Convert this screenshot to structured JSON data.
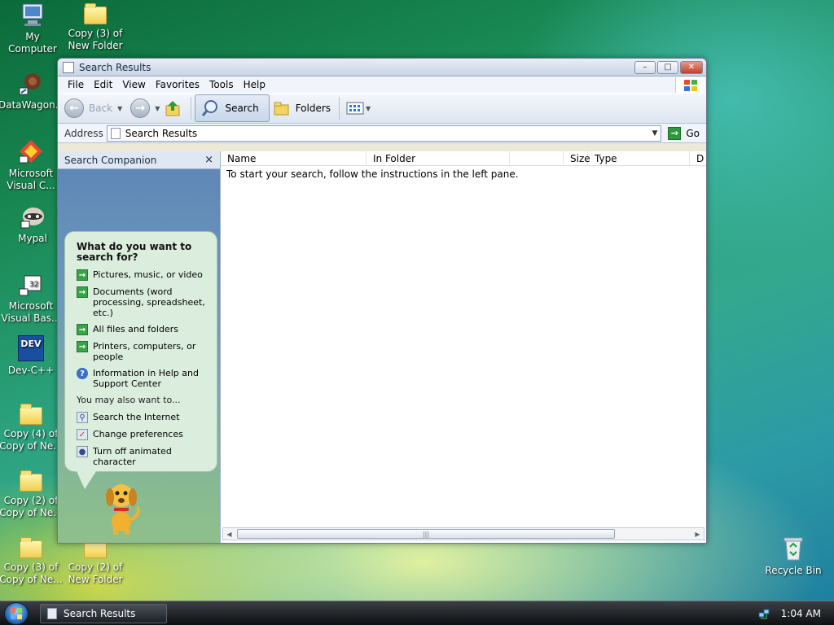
{
  "desktop": {
    "icons": [
      {
        "label_line1": "My Computer",
        "label_line2": ""
      },
      {
        "label_line1": "Copy (3) of",
        "label_line2": "New Folder"
      },
      {
        "label_line1": "DataWagon...",
        "label_line2": ""
      },
      {
        "label_line1": "Microsoft",
        "label_line2": "Visual C..."
      },
      {
        "label_line1": "Mypal",
        "label_line2": ""
      },
      {
        "label_line1": "Microsoft",
        "label_line2": "Visual Bas..."
      },
      {
        "label_line1": "Dev-C++",
        "label_line2": ""
      },
      {
        "label_line1": "Copy (4) of",
        "label_line2": "Copy of Ne..."
      },
      {
        "label_line1": "Copy (2) of",
        "label_line2": "Copy of Ne..."
      },
      {
        "label_line1": "Copy (3) of",
        "label_line2": "Copy of Ne..."
      },
      {
        "label_line1": "Copy (2) of",
        "label_line2": "New Folder"
      },
      {
        "label_line1": "Recycle Bin",
        "label_line2": ""
      }
    ],
    "dev_badge": "DEV"
  },
  "window": {
    "title": "Search Results",
    "controls": {
      "minimize": "–",
      "maximize": "□",
      "close": "✕"
    },
    "menu": [
      "File",
      "Edit",
      "View",
      "Favorites",
      "Tools",
      "Help"
    ],
    "toolbar": {
      "back_label": "Back",
      "search_label": "Search",
      "folders_label": "Folders"
    },
    "address": {
      "label": "Address",
      "value": "Search Results",
      "go_label": "Go"
    },
    "search_companion": {
      "title": "Search Companion",
      "close": "×",
      "question": "What do you want to search for?",
      "options": [
        "Pictures, music, or video",
        "Documents (word processing, spreadsheet, etc.)",
        "All files and folders",
        "Printers, computers, or people",
        "Information in Help and Support Center"
      ],
      "also_heading": "You may also want to...",
      "also_options": [
        "Search the Internet",
        "Change preferences",
        "Turn off animated character"
      ]
    },
    "results": {
      "columns": [
        "Name",
        "In Folder",
        "Size",
        "Type",
        "D"
      ],
      "empty_message": "To start your search, follow the instructions in the left pane."
    }
  },
  "taskbar": {
    "items": [
      "Search Results"
    ],
    "clock": "1:04 AM"
  },
  "colors": {
    "accent_green": "#3aa34a",
    "window_bg": "#ece9d8"
  }
}
